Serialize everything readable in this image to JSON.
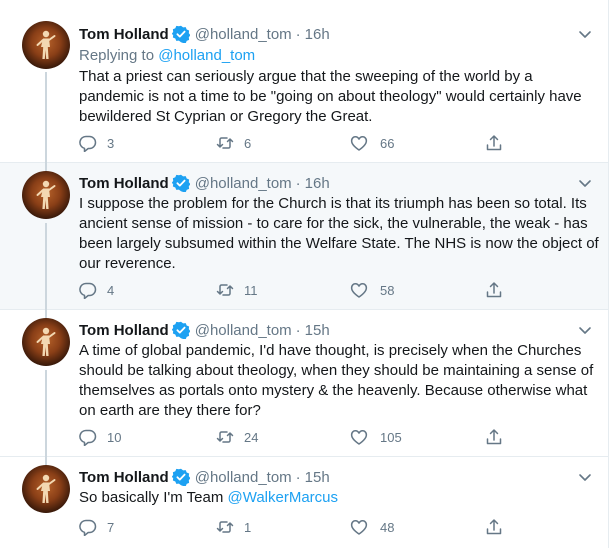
{
  "colors": {
    "accent": "#1da1f2",
    "secondary_text": "#657786",
    "primary_text": "#14171a",
    "divider": "#e6ecf0",
    "highlight_bg": "#f5f8fa"
  },
  "icons": {
    "verified": "verified-badge-icon",
    "caret": "chevron-down-icon",
    "reply": "reply-icon",
    "retweet": "retweet-icon",
    "like": "heart-icon",
    "share": "share-icon"
  },
  "tweets": [
    {
      "name": "Tom Holland",
      "handle": "@holland_tom",
      "time": "16h",
      "replying_prefix": "Replying to",
      "replying_to": "@holland_tom",
      "text": "That a priest can seriously argue that the sweeping of the world by a pandemic is not a time to be \"going on about theology\" would certainly have bewildered St Cyprian or Gregory the Great.",
      "replies": "3",
      "retweets": "6",
      "likes": "66"
    },
    {
      "name": "Tom Holland",
      "handle": "@holland_tom",
      "time": "16h",
      "text": "I suppose the problem for the Church is that its triumph has been so total. Its ancient sense of mission - to care for the sick, the vulnerable, the weak - has been largely subsumed within the Welfare State. The NHS is now the object of our reverence.",
      "replies": "4",
      "retweets": "11",
      "likes": "58"
    },
    {
      "name": "Tom Holland",
      "handle": "@holland_tom",
      "time": "15h",
      "text": "A time of global pandemic, I'd have thought, is precisely when the Churches should be talking about theology, when they should be maintaining a sense of themselves as portals onto mystery & the heavenly. Because otherwise what on earth are they there for?",
      "replies": "10",
      "retweets": "24",
      "likes": "105"
    },
    {
      "name": "Tom Holland",
      "handle": "@holland_tom",
      "time": "15h",
      "text_prefix": "So basically I'm Team",
      "mention": "@WalkerMarcus",
      "replies": "7",
      "retweets": "1",
      "likes": "48"
    }
  ],
  "separator": "·"
}
